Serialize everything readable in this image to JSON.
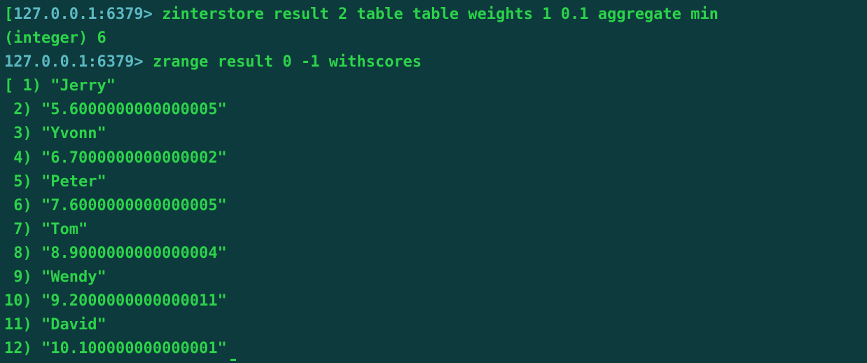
{
  "prompt": "127.0.0.1:6379>",
  "commands": {
    "cmd1": "zinterstore result 2 table table weights 1 0.1 aggregate min",
    "cmd2": "zrange result 0 -1 withscores"
  },
  "response1": "(integer) 6",
  "list": [
    {
      "idx": " 1",
      "val": "\"Jerry\""
    },
    {
      "idx": " 2",
      "val": "\"5.6000000000000005\""
    },
    {
      "idx": " 3",
      "val": "\"Yvonn\""
    },
    {
      "idx": " 4",
      "val": "\"6.7000000000000002\""
    },
    {
      "idx": " 5",
      "val": "\"Peter\""
    },
    {
      "idx": " 6",
      "val": "\"7.6000000000000005\""
    },
    {
      "idx": " 7",
      "val": "\"Tom\""
    },
    {
      "idx": " 8",
      "val": "\"8.9000000000000004\""
    },
    {
      "idx": " 9",
      "val": "\"Wendy\""
    },
    {
      "idx": "10",
      "val": "\"9.2000000000000011\""
    },
    {
      "idx": "11",
      "val": "\"David\""
    },
    {
      "idx": "12",
      "val": "\"10.100000000000001\""
    }
  ],
  "bracket_open": "[",
  "paren": ")"
}
